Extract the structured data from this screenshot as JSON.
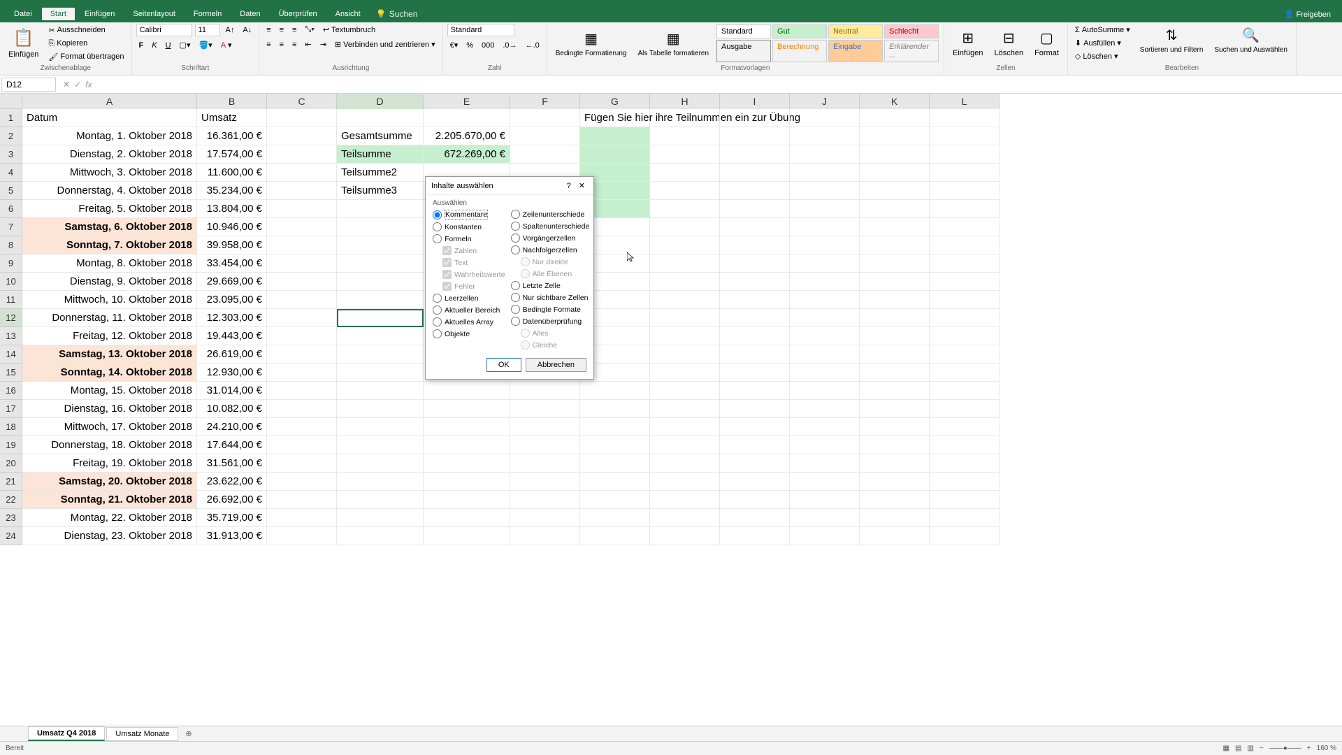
{
  "titlebar": {
    "share": "Freigeben"
  },
  "tabs": {
    "datei": "Datei",
    "start": "Start",
    "einfuegen": "Einfügen",
    "seitenlayout": "Seitenlayout",
    "formeln": "Formeln",
    "daten": "Daten",
    "ueberpruefen": "Überprüfen",
    "ansicht": "Ansicht",
    "suchen": "Suchen"
  },
  "ribbon": {
    "clipboard": {
      "einfuegen": "Einfügen",
      "ausschneiden": "Ausschneiden",
      "kopieren": "Kopieren",
      "format": "Format übertragen",
      "label": "Zwischenablage"
    },
    "font": {
      "name": "Calibri",
      "size": "11",
      "label": "Schriftart"
    },
    "alignment": {
      "textumbruch": "Textumbruch",
      "verbinden": "Verbinden und zentrieren",
      "label": "Ausrichtung"
    },
    "number": {
      "format": "Standard",
      "label": "Zahl"
    },
    "styles": {
      "bedingte": "Bedingte Formatierung",
      "alstabelle": "Als Tabelle formatieren",
      "standard": "Standard",
      "gut": "Gut",
      "neutral": "Neutral",
      "schlecht": "Schlecht",
      "ausgabe": "Ausgabe",
      "berechnung": "Berechnung",
      "eingabe": "Eingabe",
      "erklaerend": "Erklärender ...",
      "label": "Formatvorlagen"
    },
    "cells": {
      "einfuegen": "Einfügen",
      "loeschen": "Löschen",
      "format": "Format",
      "label": "Zellen"
    },
    "editing": {
      "autosumme": "AutoSumme",
      "ausfuellen": "Ausfüllen",
      "loeschen": "Löschen",
      "sortieren": "Sortieren und Filtern",
      "suchen": "Suchen und Auswählen",
      "label": "Bearbeiten"
    }
  },
  "namebox": "D12",
  "columns": [
    "A",
    "B",
    "C",
    "D",
    "E",
    "F",
    "G",
    "H",
    "I",
    "J",
    "K",
    "L"
  ],
  "headers": {
    "datum": "Datum",
    "umsatz": "Umsatz"
  },
  "g1text": "Fügen Sie hier ihre Teilnummen ein zur Übung",
  "summary": {
    "gesamt_label": "Gesamtsumme",
    "gesamt_val": "2.205.670,00 €",
    "teil_label": "Teilsumme",
    "teil_val": "672.269,00 €",
    "teil2_label": "Teilsumme2",
    "teil3_label": "Teilsumme3"
  },
  "rows": [
    {
      "n": 1,
      "a": "Datum",
      "b": "Umsatz",
      "hdr": true
    },
    {
      "n": 2,
      "a": "Montag, 1. Oktober 2018",
      "b": "16.361,00 €"
    },
    {
      "n": 3,
      "a": "Dienstag, 2. Oktober 2018",
      "b": "17.574,00 €"
    },
    {
      "n": 4,
      "a": "Mittwoch, 3. Oktober 2018",
      "b": "11.600,00 €"
    },
    {
      "n": 5,
      "a": "Donnerstag, 4. Oktober 2018",
      "b": "35.234,00 €"
    },
    {
      "n": 6,
      "a": "Freitag, 5. Oktober 2018",
      "b": "13.804,00 €"
    },
    {
      "n": 7,
      "a": "Samstag, 6. Oktober 2018",
      "b": "10.946,00 €",
      "we": true
    },
    {
      "n": 8,
      "a": "Sonntag, 7. Oktober 2018",
      "b": "39.958,00 €",
      "we": true
    },
    {
      "n": 9,
      "a": "Montag, 8. Oktober 2018",
      "b": "33.454,00 €"
    },
    {
      "n": 10,
      "a": "Dienstag, 9. Oktober 2018",
      "b": "29.669,00 €"
    },
    {
      "n": 11,
      "a": "Mittwoch, 10. Oktober 2018",
      "b": "23.095,00 €"
    },
    {
      "n": 12,
      "a": "Donnerstag, 11. Oktober 2018",
      "b": "12.303,00 €"
    },
    {
      "n": 13,
      "a": "Freitag, 12. Oktober 2018",
      "b": "19.443,00 €"
    },
    {
      "n": 14,
      "a": "Samstag, 13. Oktober 2018",
      "b": "26.619,00 €",
      "we": true
    },
    {
      "n": 15,
      "a": "Sonntag, 14. Oktober 2018",
      "b": "12.930,00 €",
      "we": true
    },
    {
      "n": 16,
      "a": "Montag, 15. Oktober 2018",
      "b": "31.014,00 €"
    },
    {
      "n": 17,
      "a": "Dienstag, 16. Oktober 2018",
      "b": "10.082,00 €"
    },
    {
      "n": 18,
      "a": "Mittwoch, 17. Oktober 2018",
      "b": "24.210,00 €"
    },
    {
      "n": 19,
      "a": "Donnerstag, 18. Oktober 2018",
      "b": "17.644,00 €"
    },
    {
      "n": 20,
      "a": "Freitag, 19. Oktober 2018",
      "b": "31.561,00 €"
    },
    {
      "n": 21,
      "a": "Samstag, 20. Oktober 2018",
      "b": "23.622,00 €",
      "we": true
    },
    {
      "n": 22,
      "a": "Sonntag, 21. Oktober 2018",
      "b": "26.692,00 €",
      "we": true
    },
    {
      "n": 23,
      "a": "Montag, 22. Oktober 2018",
      "b": "35.719,00 €"
    },
    {
      "n": 24,
      "a": "Dienstag, 23. Oktober 2018",
      "b": "31.913,00 €"
    }
  ],
  "dialog": {
    "title": "Inhalte auswählen",
    "section": "Auswählen",
    "left": {
      "kommentare": "Kommentare",
      "konstanten": "Konstanten",
      "formeln": "Formeln",
      "zahlen": "Zahlen",
      "text": "Text",
      "wahrheit": "Wahrheitswerte",
      "fehler": "Fehler",
      "leerzellen": "Leerzellen",
      "aktbereich": "Aktueller Bereich",
      "aktarray": "Aktuelles Array",
      "objekte": "Objekte"
    },
    "right": {
      "zeilenunter": "Zeilenunterschiede",
      "spaltenunter": "Spaltenunterschiede",
      "vorgaenger": "Vorgängerzellen",
      "nachfolger": "Nachfolgerzellen",
      "nurdirekte": "Nur direkte",
      "alleebenen": "Alle Ebenen",
      "letzte": "Letzte Zelle",
      "sichtbare": "Nur sichtbare Zellen",
      "bedingte": "Bedingte Formate",
      "datenueber": "Datenüberprüfung",
      "alles": "Alles",
      "gleiche": "Gleiche"
    },
    "ok": "OK",
    "cancel": "Abbrechen"
  },
  "sheettabs": {
    "tab1": "Umsatz Q4 2018",
    "tab2": "Umsatz Monate"
  },
  "status": {
    "ready": "Bereit",
    "zoom": "160 %"
  }
}
